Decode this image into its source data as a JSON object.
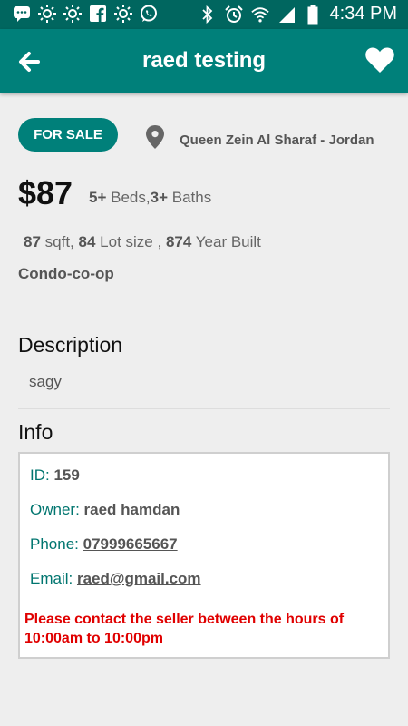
{
  "status_bar": {
    "time": "4:34 PM",
    "left_icons": [
      "chat-icon",
      "sun-icon",
      "sun-icon",
      "facebook-icon",
      "sun-icon",
      "whatsapp-icon"
    ],
    "right_icons": [
      "bluetooth-icon",
      "alarm-icon",
      "wifi-icon",
      "signal-icon",
      "battery-icon"
    ]
  },
  "app_bar": {
    "title": "raed testing"
  },
  "listing": {
    "status": "FOR SALE",
    "location": "Queen Zein Al Sharaf - Jordan",
    "price": "$87",
    "beds": "5+",
    "beds_label": "Beds,",
    "baths": "3+",
    "baths_label": "Baths",
    "sqft": "87",
    "sqft_label": "sqft,",
    "lot_size": "84",
    "lot_size_label": "Lot size ,",
    "year_built": "874",
    "year_built_label": "Year Built",
    "type": "Condo-co-op"
  },
  "description": {
    "heading": "Description",
    "text": "sagy"
  },
  "info": {
    "heading": "Info",
    "id_label": "ID:",
    "id_value": "159",
    "owner_label": "Owner:",
    "owner_value": "raed hamdan",
    "phone_label": "Phone:",
    "phone_value": "07999665667",
    "email_label": "Email:",
    "email_value": "raed@gmail.com",
    "notice": "Please contact the seller between the hours of 10:00am to 10:00pm"
  },
  "colors": {
    "status_bar": "#00665f",
    "app_bar": "#00807a",
    "accent_text": "#00756f",
    "notice": "#e00000"
  }
}
